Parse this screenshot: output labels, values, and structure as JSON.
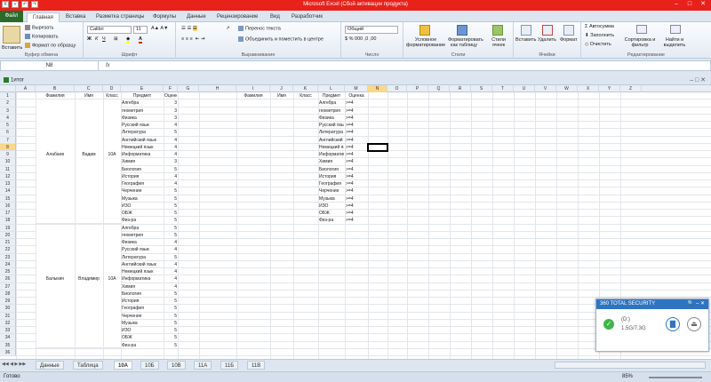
{
  "window": {
    "title": "Microsoft Excel (Сбой активации продукта)"
  },
  "tabs": {
    "file": "Файл",
    "items": [
      "Главная",
      "Вставка",
      "Разметка страницы",
      "Формулы",
      "Данные",
      "Рецензирование",
      "Вид",
      "Разработчик"
    ]
  },
  "ribbon": {
    "clipboard": {
      "paste": "Вставить",
      "cut": "Вырезать",
      "copy": "Копировать",
      "format": "Формат по образцу",
      "label": "Буфер обмена"
    },
    "font": {
      "name": "Calibri",
      "size": "11",
      "label": "Шрифт"
    },
    "align": {
      "wrap": "Перенос текста",
      "merge": "Объединить и поместить в центре",
      "label": "Выравнивание"
    },
    "number": {
      "format": "Общий",
      "label": "Число"
    },
    "styles": {
      "cond": "Условное форматирование",
      "table": "Форматировать как таблицу",
      "cell": "Стили ячеек",
      "label": "Стили"
    },
    "cells": {
      "insert": "Вставить",
      "delete": "Удалить",
      "format": "Формат",
      "label": "Ячейки"
    },
    "edit": {
      "autosum": "Автосумма",
      "fill": "Заполнить",
      "clear": "Очистить",
      "sort": "Сортировка и фильтр",
      "find": "Найти и выделить",
      "label": "Редактирование"
    }
  },
  "formula_bar": {
    "namebox": "N8",
    "fx": "fx",
    "value": ""
  },
  "workbook": {
    "title": "1итог"
  },
  "columns": [
    "A",
    "B",
    "C",
    "D",
    "E",
    "F",
    "G",
    "H",
    "I",
    "J",
    "K",
    "L",
    "M",
    "N",
    "O",
    "P",
    "Q",
    "R",
    "S",
    "T",
    "U",
    "V",
    "W",
    "X",
    "Y",
    "Z"
  ],
  "header": {
    "a": "Фамилия",
    "b": "Имя",
    "c": "Класс",
    "d": "Предмет",
    "e": "Оценка",
    "h": "Фамилия",
    "i": "Имя",
    "j": "Класс",
    "k": "Предмет",
    "l": "Оценка"
  },
  "student1": {
    "last": "Алабаев",
    "first": "Вадим",
    "class": "10А"
  },
  "student2": {
    "last": "Балыкин",
    "first": "Владимир",
    "class": "10А"
  },
  "subjects": [
    "Алгебра",
    "геометрия",
    "Физика",
    "Русский язык",
    "Литература",
    "Английский язык",
    "Немецкий язык",
    "Информатика",
    "Химия",
    "Биология",
    "История",
    "География",
    "Черчение",
    "Музыка",
    "ИЗО",
    "ОБЖ",
    "Физ-ра"
  ],
  "grades1": [
    "3",
    "3",
    "3",
    "4",
    "5",
    "4",
    "4",
    "4",
    "3",
    "5",
    "4",
    "4",
    "5",
    "5",
    "5",
    "5",
    "5"
  ],
  "grades2": [
    "5",
    "5",
    "4",
    "4",
    "5",
    "4",
    "4",
    "4",
    "4",
    "5",
    "5",
    "5",
    "5",
    "5",
    "5",
    "5",
    "5"
  ],
  "criteria": [
    ">=4",
    ">=4",
    ">=4",
    ">=4",
    ">=4",
    ">=4",
    ">=4",
    ">=4",
    ">=4",
    ">=4",
    ">=4",
    ">=4",
    ">=4",
    ">=4",
    ">=4",
    ">=4",
    ">=4"
  ],
  "sheets": [
    "Данные",
    "Таблица",
    "10А",
    "10Б",
    "10В",
    "11А",
    "11Б",
    "11В"
  ],
  "active_sheet": "10А",
  "status": {
    "ready": "Готово",
    "zoom": "85%"
  },
  "popup": {
    "title": "360 TOTAL SECURITY",
    "drive": "(D:)",
    "size": "1.5G/7.3G"
  }
}
